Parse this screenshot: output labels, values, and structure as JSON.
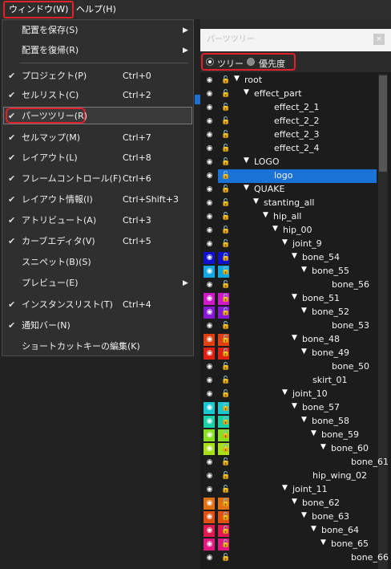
{
  "menubar": {
    "window_label": "ウィンドウ(W)",
    "help_label": "ヘルプ(H)"
  },
  "menu_items": [
    {
      "label": "配置を保存(S)",
      "checked": false,
      "shortcut": "",
      "submenu": true
    },
    {
      "label": "配置を復帰(R)",
      "checked": false,
      "shortcut": "",
      "submenu": true
    },
    {
      "label": "プロジェクト(P)",
      "checked": true,
      "shortcut": "Ctrl+0",
      "submenu": false
    },
    {
      "label": "セルリスト(C)",
      "checked": true,
      "shortcut": "Ctrl+2",
      "submenu": false
    },
    {
      "label": "パーツツリー(R)",
      "checked": true,
      "shortcut": "",
      "submenu": false
    },
    {
      "label": "セルマップ(M)",
      "checked": true,
      "shortcut": "Ctrl+7",
      "submenu": false
    },
    {
      "label": "レイアウト(L)",
      "checked": true,
      "shortcut": "Ctrl+8",
      "submenu": false
    },
    {
      "label": "フレームコントロール(F)",
      "checked": true,
      "shortcut": "Ctrl+6",
      "submenu": false
    },
    {
      "label": "レイアウト情報(I)",
      "checked": true,
      "shortcut": "Ctrl+Shift+3",
      "submenu": false
    },
    {
      "label": "アトリビュート(A)",
      "checked": true,
      "shortcut": "Ctrl+3",
      "submenu": false
    },
    {
      "label": "カーブエディタ(V)",
      "checked": true,
      "shortcut": "Ctrl+5",
      "submenu": false
    },
    {
      "label": "スニペット(B)(S)",
      "checked": false,
      "shortcut": "",
      "submenu": false
    },
    {
      "label": "プレビュー(E)",
      "checked": false,
      "shortcut": "",
      "submenu": true
    },
    {
      "label": "インスタンスリスト(T)",
      "checked": true,
      "shortcut": "Ctrl+4",
      "submenu": false
    },
    {
      "label": "通知バー(N)",
      "checked": true,
      "shortcut": "",
      "submenu": false
    },
    {
      "label": "ショートカットキーの編集(K)",
      "checked": false,
      "shortcut": "",
      "submenu": false
    }
  ],
  "panel": {
    "title": "パーツツリー",
    "mode_tree": "ツリー",
    "mode_priority": "優先度",
    "close_glyph": "×"
  },
  "tree": [
    {
      "name": "root",
      "depth": 0,
      "expanded": true,
      "color": ""
    },
    {
      "name": "effect_part",
      "depth": 1,
      "expanded": true,
      "color": ""
    },
    {
      "name": "effect_2_1",
      "depth": 2,
      "expanded": null,
      "color": ""
    },
    {
      "name": "effect_2_2",
      "depth": 2,
      "expanded": null,
      "color": ""
    },
    {
      "name": "effect_2_3",
      "depth": 2,
      "expanded": null,
      "color": ""
    },
    {
      "name": "effect_2_4",
      "depth": 2,
      "expanded": null,
      "color": ""
    },
    {
      "name": "LOGO",
      "depth": 1,
      "expanded": true,
      "color": ""
    },
    {
      "name": "logo",
      "depth": 2,
      "expanded": null,
      "color": "",
      "selected": true
    },
    {
      "name": "QUAKE",
      "depth": 1,
      "expanded": true,
      "color": ""
    },
    {
      "name": "stanting_all",
      "depth": 2,
      "expanded": true,
      "color": ""
    },
    {
      "name": "hip_all",
      "depth": 3,
      "expanded": true,
      "color": ""
    },
    {
      "name": "hip_00",
      "depth": 4,
      "expanded": true,
      "color": ""
    },
    {
      "name": "joint_9",
      "depth": 5,
      "expanded": true,
      "color": ""
    },
    {
      "name": "bone_54",
      "depth": 6,
      "expanded": true,
      "color": "#1010d0"
    },
    {
      "name": "bone_55",
      "depth": 7,
      "expanded": true,
      "color": "#10a8e0"
    },
    {
      "name": "bone_56",
      "depth": 8,
      "expanded": null,
      "color": ""
    },
    {
      "name": "bone_51",
      "depth": 6,
      "expanded": true,
      "color": "#d018c8"
    },
    {
      "name": "bone_52",
      "depth": 7,
      "expanded": true,
      "color": "#8818d8"
    },
    {
      "name": "bone_53",
      "depth": 8,
      "expanded": null,
      "color": ""
    },
    {
      "name": "bone_48",
      "depth": 6,
      "expanded": true,
      "color": "#e04010"
    },
    {
      "name": "bone_49",
      "depth": 7,
      "expanded": true,
      "color": "#e02010"
    },
    {
      "name": "bone_50",
      "depth": 8,
      "expanded": null,
      "color": ""
    },
    {
      "name": "skirt_01",
      "depth": 6,
      "expanded": null,
      "color": ""
    },
    {
      "name": "joint_10",
      "depth": 5,
      "expanded": true,
      "color": ""
    },
    {
      "name": "bone_57",
      "depth": 6,
      "expanded": true,
      "color": "#18c8d0"
    },
    {
      "name": "bone_58",
      "depth": 7,
      "expanded": true,
      "color": "#18d0a8"
    },
    {
      "name": "bone_59",
      "depth": 8,
      "expanded": true,
      "color": "#88e020"
    },
    {
      "name": "bone_60",
      "depth": 9,
      "expanded": true,
      "color": "#a8e018"
    },
    {
      "name": "bone_61",
      "depth": 10,
      "expanded": null,
      "color": ""
    },
    {
      "name": "hip_wing_02",
      "depth": 6,
      "expanded": null,
      "color": ""
    },
    {
      "name": "joint_11",
      "depth": 5,
      "expanded": true,
      "color": ""
    },
    {
      "name": "bone_62",
      "depth": 6,
      "expanded": true,
      "color": "#e07010"
    },
    {
      "name": "bone_63",
      "depth": 7,
      "expanded": true,
      "color": "#e05010"
    },
    {
      "name": "bone_64",
      "depth": 8,
      "expanded": true,
      "color": "#e01850"
    },
    {
      "name": "bone_65",
      "depth": 9,
      "expanded": true,
      "color": "#e01880"
    },
    {
      "name": "bone_66",
      "depth": 10,
      "expanded": null,
      "color": ""
    }
  ]
}
